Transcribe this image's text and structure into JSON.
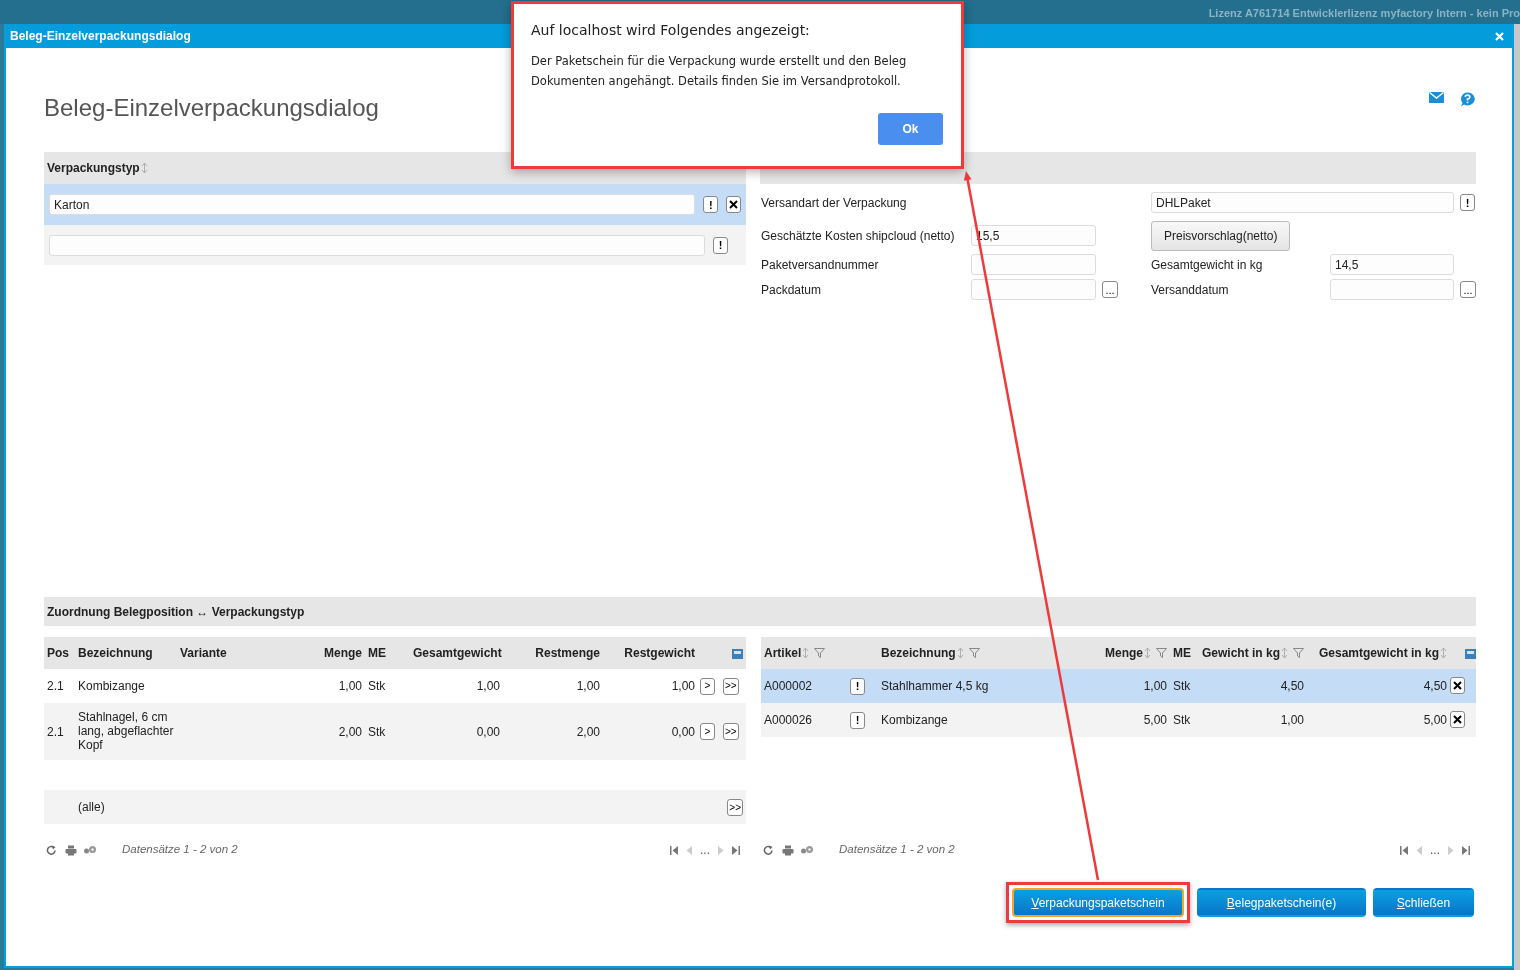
{
  "top_bar": {
    "license": "Lizenz A761714 Entwicklerlizenz myfactory Intern - kein Pro"
  },
  "dialog": {
    "title": "Beleg-Einzelverpackungsdialog",
    "heading": "Beleg-Einzelverpackungsdialog"
  },
  "packaging_types": {
    "header": "Verpackungstyp",
    "sortable": true,
    "rows": [
      {
        "value": "Karton",
        "hint": "!",
        "removable": true,
        "selected": true
      },
      {
        "hint": "!",
        "removable": false,
        "selected": false
      }
    ]
  },
  "details": {
    "rows": [
      {
        "left": {
          "kind": "label",
          "label": "Versandart der Verpackung"
        },
        "right": {
          "kind": "wide",
          "value": "DHLPaket",
          "hint": "!"
        }
      },
      {
        "left": {
          "kind": "field",
          "label": "Geschätzte Kosten shipcloud (netto)",
          "value": "15,5"
        },
        "right": {
          "kind": "button",
          "button": "Preisvorschlag(netto)"
        }
      },
      {
        "left": {
          "kind": "field",
          "label": "Paketversandnummer"
        },
        "right": {
          "kind": "field",
          "label": "Gesamtgewicht in kg",
          "value": "14,5"
        }
      },
      {
        "left": {
          "kind": "date",
          "label": "Packdatum",
          "picker": "..."
        },
        "right": {
          "kind": "date",
          "label": "Versanddatum",
          "picker": "..."
        }
      }
    ]
  },
  "assignment": {
    "header": "Zuordnung Belegposition ↔ Verpackungstyp",
    "positions": {
      "columns": [
        {
          "label": "Pos",
          "kind": "text"
        },
        {
          "label": "Bezeichnung",
          "kind": "text"
        },
        {
          "label": "Variante",
          "kind": "text"
        },
        {
          "label": "Menge",
          "kind": "number"
        },
        {
          "label": "ME",
          "kind": "text"
        },
        {
          "label": "Gesamtgewicht",
          "kind": "number"
        },
        {
          "label": "Restmenge",
          "kind": "number"
        },
        {
          "label": "Restgewicht",
          "kind": "number"
        }
      ],
      "rows": [
        {
          "cells": [
            "2.1",
            "Kombizange",
            null,
            "1,00",
            "Stk",
            "1,00",
            "1,00",
            "1,00"
          ],
          "actions": [
            ">",
            ">>"
          ]
        },
        {
          "cells": [
            "2.1",
            "Stahlnagel, 6 cm lang, abgeflachter Kopf",
            null,
            "2,00",
            "Stk",
            "0,00",
            "2,00",
            "0,00"
          ],
          "actions": [
            ">",
            ">>"
          ]
        }
      ],
      "all_row": {
        "label": "(alle)",
        "action": ">>"
      },
      "footer": {
        "records": "Datensätze 1 - 2 von 2",
        "pager_gap": "..."
      }
    },
    "items": {
      "columns": [
        {
          "label": "Artikel",
          "kind": "text",
          "sortable": true,
          "filterable": true
        },
        {
          "label": "Bezeichnung",
          "kind": "text",
          "sortable": true,
          "filterable": true
        },
        {
          "label": "Menge",
          "kind": "number",
          "sortable": true,
          "filterable": true
        },
        {
          "label": "ME",
          "kind": "text",
          "sortable": false,
          "filterable": false
        },
        {
          "label": "Gewicht in kg",
          "kind": "number",
          "sortable": true,
          "filterable": true
        },
        {
          "label": "Gesamtgewicht in kg",
          "kind": "number",
          "sortable": true,
          "filterable": false
        }
      ],
      "rows": [
        {
          "cells": [
            "A000002",
            "Stahlhammer 4,5 kg",
            "1,00",
            "Stk",
            "4,50",
            "4,50"
          ],
          "hint": "!",
          "removable": true,
          "selected": true
        },
        {
          "cells": [
            "A000026",
            "Kombizange",
            "5,00",
            "Stk",
            "1,00",
            "5,00"
          ],
          "hint": "!",
          "removable": true,
          "selected": false
        }
      ],
      "footer": {
        "records": "Datensätze 1 - 2 von 2",
        "pager_gap": "..."
      }
    }
  },
  "buttons": [
    {
      "mnemonic": "V",
      "rest": "erpackungspaketschein",
      "focused": true
    },
    {
      "mnemonic": "B",
      "rest": "elegpaketschein(e)",
      "focused": false
    },
    {
      "mnemonic": "S",
      "rest": "chließen",
      "focused": false
    }
  ],
  "alert": {
    "title": "Auf localhost wird Folgendes angezeigt:",
    "message": "Der Paketschein für die Verpackung wurde erstellt und den Beleg Dokumenten angehängt. Details finden Sie im Versandprotokoll.",
    "ok": "Ok"
  },
  "annotations": [
    {
      "kind": "alert-frame"
    },
    {
      "kind": "button-frame"
    },
    {
      "kind": "arrow"
    }
  ]
}
